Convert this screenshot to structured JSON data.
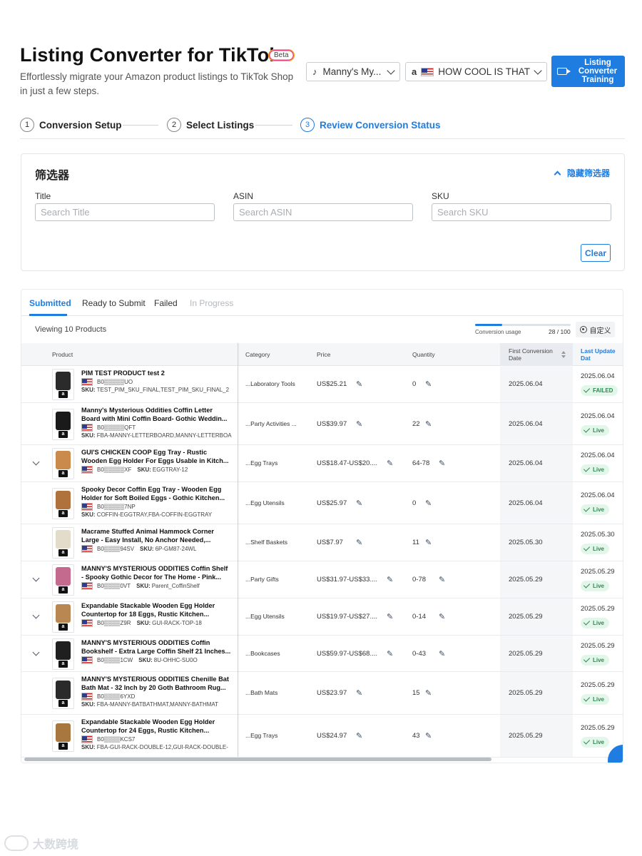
{
  "header": {
    "title": "Listing Converter for TikTok",
    "badge": "Beta",
    "subtitle": "Effortlessly migrate your Amazon product listings to TikTok Shop in just a few steps.",
    "tiktok_shop_select": "Manny's My...",
    "amazon_store_select": "HOW COOL IS THAT",
    "training_button": "Listing Converter Training"
  },
  "steps": [
    {
      "num": "1",
      "label": "Conversion Setup",
      "active": false
    },
    {
      "num": "2",
      "label": "Select Listings",
      "active": false
    },
    {
      "num": "3",
      "label": "Review Conversion Status",
      "active": true
    }
  ],
  "filter": {
    "title": "筛选器",
    "hide_label": "隐藏筛选器",
    "fields": [
      {
        "label": "Title",
        "placeholder": "Search Title"
      },
      {
        "label": "ASIN",
        "placeholder": "Search ASIN"
      },
      {
        "label": "SKU",
        "placeholder": "Search SKU"
      }
    ],
    "clear_button": "Clear"
  },
  "tabs": [
    {
      "label": "Submitted",
      "state": "active"
    },
    {
      "label": "Ready to Submit",
      "state": "normal"
    },
    {
      "label": "Failed",
      "state": "normal"
    },
    {
      "label": "In Progress",
      "state": "disabled"
    }
  ],
  "toolbar": {
    "viewing": "Viewing 10 Products",
    "usage_label": "Conversion usage",
    "usage_count": "28 / 100",
    "usage_fraction": 0.28,
    "custom_button": "自定义"
  },
  "table": {
    "headers": {
      "product": "Product",
      "category": "Category",
      "price": "Price",
      "quantity": "Quantity",
      "first_conversion_date": "First Conversion Date",
      "last_update": "Last Update Dat"
    },
    "rows": [
      {
        "expandable": false,
        "title": "PIM TEST PRODUCT test 2",
        "asin": "B0▒▒▒▒▒UO",
        "sku_inline": "",
        "sku_line": "TEST_PIM_SKU_FINAL,TEST_PIM_SKU_FINAL_2",
        "category": "...Laboratory Tools",
        "price": "US$25.21",
        "quantity": "0",
        "first_date": "2025.06.04",
        "update_date": "2025.06.04",
        "status": "FAILED",
        "thumb_color": "#2b2b2b"
      },
      {
        "expandable": false,
        "title": "Manny's Mysterious Oddities Coffin Letter Board with Mini Coffin Board- Gothic Weddin...",
        "asin": "B0▒▒▒▒▒QFT",
        "sku_inline": "",
        "sku_line": "FBA-MANNY-LETTERBOARD,MANNY-LETTERBOA",
        "category": "...Party Activities ...",
        "price": "US$39.97",
        "quantity": "22",
        "first_date": "2025.06.04",
        "update_date": "2025.06.04",
        "status": "Live",
        "thumb_color": "#1a1a1a"
      },
      {
        "expandable": true,
        "title": "GUI'S CHICKEN COOP Egg Tray - Rustic Wooden Egg Holder For Eggs Usable in Kitch...",
        "asin": "B0▒▒▒▒▒XF",
        "sku_inline": "EGGTRAY-12",
        "sku_line": "",
        "category": "...Egg Trays",
        "price": "US$18.47-US$20....",
        "quantity": "64-78",
        "first_date": "2025.06.04",
        "update_date": "2025.06.04",
        "status": "Live",
        "thumb_color": "#c98a4b"
      },
      {
        "expandable": false,
        "title": "Spooky Decor Coffin Egg Tray - Wooden Egg Holder for Soft Boiled Eggs - Gothic Kitchen...",
        "asin": "B0▒▒▒▒▒7NP",
        "sku_inline": "",
        "sku_line": "COFFIN-EGGTRAY,FBA-COFFIN-EGGTRAY",
        "category": "...Egg Utensils",
        "price": "US$25.97",
        "quantity": "0",
        "first_date": "2025.06.04",
        "update_date": "2025.06.04",
        "status": "Live",
        "thumb_color": "#b0723c"
      },
      {
        "expandable": false,
        "title": "Macrame Stuffed Animal Hammock Corner Large - Easy Install, No Anchor Needed,...",
        "asin": "B0▒▒▒▒94SV",
        "sku_inline": "6P-GM87-24WL",
        "sku_line": "",
        "category": "...Shelf Baskets",
        "price": "US$7.97",
        "quantity": "11",
        "first_date": "2025.05.30",
        "update_date": "2025.05.30",
        "status": "Live",
        "thumb_color": "#e4dccb"
      },
      {
        "expandable": true,
        "title": "MANNY'S MYSTERIOUS ODDITIES Coffin Shelf - Spooky Gothic Decor for The Home - Pink...",
        "asin": "B0▒▒▒▒0VT",
        "sku_inline": "Parent_CoffinShelf",
        "sku_line": "",
        "category": "...Party Gifts",
        "price": "US$31.97-US$33....",
        "quantity": "0-78",
        "first_date": "2025.05.29",
        "update_date": "2025.05.29",
        "status": "Live",
        "thumb_color": "#c46a8e"
      },
      {
        "expandable": true,
        "title": "Expandable Stackable Wooden Egg Holder Countertop for 18 Eggs, Rustic Kitchen...",
        "asin": "B0▒▒▒▒Z9R",
        "sku_inline": "GUI-RACK-TOP-18",
        "sku_line": "",
        "category": "...Egg Utensils",
        "price": "US$19.97-US$27....",
        "quantity": "0-14",
        "first_date": "2025.05.29",
        "update_date": "2025.05.29",
        "status": "Live",
        "thumb_color": "#b98752"
      },
      {
        "expandable": true,
        "title": "MANNY'S MYSTERIOUS ODDITIES Coffin Bookshelf - Extra Large Coffin Shelf 21 Inches...",
        "asin": "B0▒▒▒▒1CW",
        "sku_inline": "8U-OHHC-SU0O",
        "sku_line": "",
        "category": "...Bookcases",
        "price": "US$59.97-US$68....",
        "quantity": "0-43",
        "first_date": "2025.05.29",
        "update_date": "2025.05.29",
        "status": "Live",
        "thumb_color": "#1f1f1f"
      },
      {
        "expandable": false,
        "title": "MANNY'S MYSTERIOUS ODDITIES Chenille Bat Bath Mat - 32 Inch by 20 Goth Bathroom Rug...",
        "asin": "B0▒▒▒▒6YXD",
        "sku_inline": "",
        "sku_line": "FBA-MANNY-BATBATHMAT,MANNY-BATHMAT",
        "category": "...Bath Mats",
        "price": "US$23.97",
        "quantity": "15",
        "first_date": "2025.05.29",
        "update_date": "2025.05.29",
        "status": "Live",
        "thumb_color": "#2a2a2a"
      },
      {
        "expandable": false,
        "title": "Expandable Stackable Wooden Egg Holder Countertop for 24 Eggs, Rustic Kitchen...",
        "asin": "B0▒▒▒▒KCS7",
        "sku_inline": "",
        "sku_line": "FBA-GUI-RACK-DOUBLE-12,GUI-RACK-DOUBLE-",
        "category": "...Egg Trays",
        "price": "US$24.97",
        "quantity": "43",
        "first_date": "2025.05.29",
        "update_date": "2025.05.29",
        "status": "Live",
        "thumb_color": "#a8763f"
      }
    ]
  },
  "labels": {
    "sku_prefix": "SKU:",
    "amazon_mark": "a"
  },
  "watermark": "大数跨境",
  "colors": {
    "accent": "#1f7ce0",
    "live_bg": "#e3f6ea",
    "live_text": "#2f8a53"
  }
}
